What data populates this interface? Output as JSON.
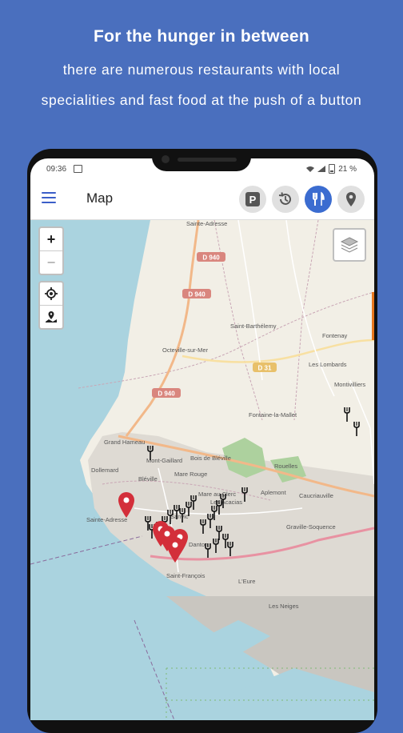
{
  "promo": {
    "headline": "For the hunger in between",
    "line1": "there are numerous restaurants with local",
    "line2": "specialities and fast food at the push of a button"
  },
  "status_bar": {
    "time": "09:36",
    "battery": "21 %"
  },
  "app_bar": {
    "title": "Map",
    "filters": [
      {
        "id": "parking",
        "icon": "parking-icon",
        "label": "P",
        "active": false
      },
      {
        "id": "history",
        "icon": "history-icon",
        "active": false
      },
      {
        "id": "restaurants",
        "icon": "restaurant-icon",
        "active": true
      },
      {
        "id": "places",
        "icon": "location-pin-icon",
        "active": false
      }
    ]
  },
  "map_controls": {
    "zoom_in": "+",
    "zoom_out": "−"
  },
  "map": {
    "road_shields": [
      "D 940",
      "D 940",
      "D 940",
      "D 31"
    ],
    "places": [
      "Sainte-Adresse",
      "Octeville-sur-Mer",
      "Saint-Barthélemy",
      "Fontenay",
      "Les Lombards",
      "Montivilliers",
      "Fontaine-la-Mallet",
      "Grand Hameau",
      "Bois de Bléville",
      "Mont-Gaillard",
      "Bléville",
      "Dollemard",
      "Mare Rouge",
      "Rouelles",
      "Mare au Clerc",
      "Les Acacias",
      "Aplemont",
      "Caucriauville",
      "Sanvic",
      "Graville-Soquence",
      "Sainte-Adresse",
      "Saint-François",
      "L'Eure",
      "Les Neiges",
      "Danton"
    ]
  },
  "colors": {
    "background": "#4a6fbe",
    "accent": "#3b6cd0",
    "pin": "#d32f3a",
    "land": "#f2efe6",
    "urban": "#dedad3",
    "sea": "#aad3df",
    "forest": "#add19e"
  }
}
